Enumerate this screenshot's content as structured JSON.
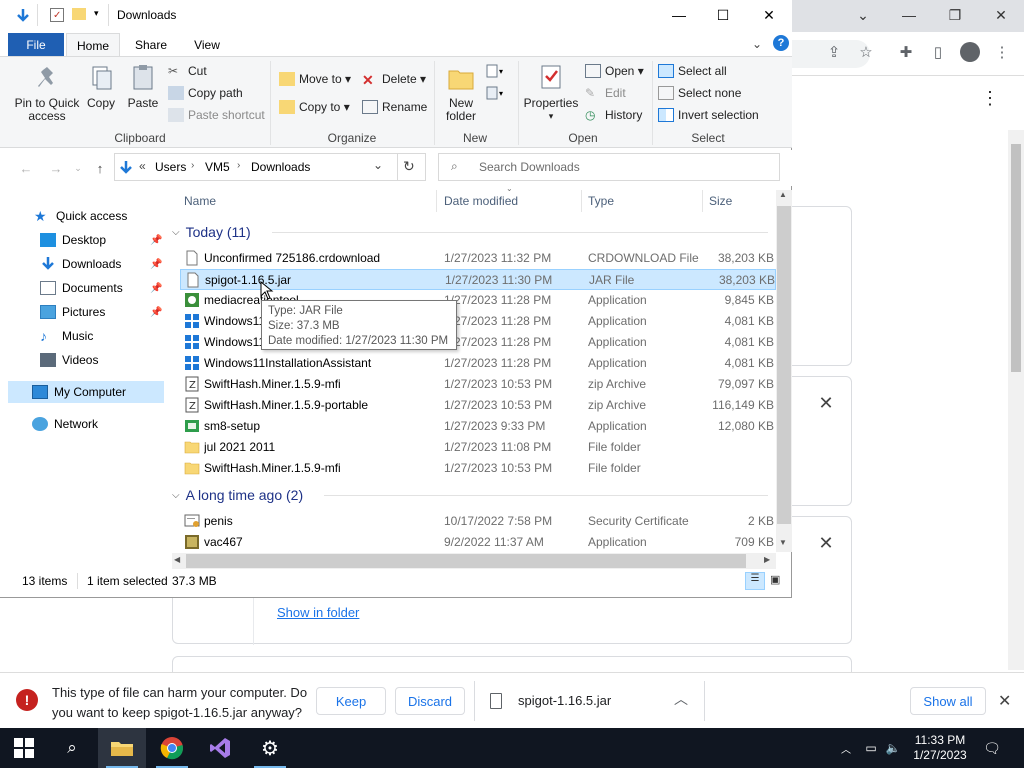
{
  "explorer": {
    "title": "Downloads",
    "tabs": [
      "File",
      "Home",
      "Share",
      "View"
    ],
    "ribbon": {
      "clipboard": {
        "pin": "Pin to Quick access",
        "copy": "Copy",
        "paste": "Paste",
        "cut": "Cut",
        "copy_path": "Copy path",
        "paste_shortcut": "Paste shortcut",
        "label": "Clipboard"
      },
      "organize": {
        "move_to": "Move to",
        "copy_to": "Copy to",
        "delete": "Delete",
        "rename": "Rename",
        "label": "Organize"
      },
      "new": {
        "new_folder": "New folder",
        "label": "New"
      },
      "open": {
        "properties": "Properties",
        "open": "Open",
        "edit": "Edit",
        "history": "History",
        "label": "Open"
      },
      "select": {
        "select_all": "Select all",
        "select_none": "Select none",
        "invert": "Invert selection",
        "label": "Select"
      }
    },
    "address": {
      "prefix": "«",
      "crumbs": [
        "Users",
        "VM5",
        "Downloads"
      ]
    },
    "search_placeholder": "Search Downloads",
    "nav": {
      "quick_access": "Quick access",
      "items": [
        "Desktop",
        "Downloads",
        "Documents",
        "Pictures",
        "Music",
        "Videos"
      ],
      "my_computer": "My Computer",
      "network": "Network"
    },
    "columns": {
      "name": "Name",
      "date": "Date modified",
      "type": "Type",
      "size": "Size"
    },
    "groups": {
      "today": "Today (11)",
      "long_ago": "A long time ago (2)"
    },
    "files_today": [
      {
        "name": "Unconfirmed 725186.crdownload",
        "date": "1/27/2023 11:32 PM",
        "type": "CRDOWNLOAD File",
        "size": "38,203 KB",
        "icon": "blank-file-icon"
      },
      {
        "name": "spigot-1.16.5.jar",
        "date": "1/27/2023 11:30 PM",
        "type": "JAR File",
        "size": "38,203 KB",
        "icon": "blank-file-icon"
      },
      {
        "name": "mediacreationtool",
        "date": "1/27/2023 11:28 PM",
        "type": "Application",
        "size": "9,845 KB",
        "icon": "media-tool-icon"
      },
      {
        "name": "Windows11",
        "date": "1/27/2023 11:28 PM",
        "type": "Application",
        "size": "4,081 KB",
        "icon": "windows-logo-icon"
      },
      {
        "name": "Windows11",
        "date": "1/27/2023 11:28 PM",
        "type": "Application",
        "size": "4,081 KB",
        "icon": "windows-logo-icon"
      },
      {
        "name": "Windows11InstallationAssistant",
        "date": "1/27/2023 11:28 PM",
        "type": "Application",
        "size": "4,081 KB",
        "icon": "windows-logo-icon"
      },
      {
        "name": "SwiftHash.Miner.1.5.9-mfi",
        "date": "1/27/2023 10:53 PM",
        "type": "zip Archive",
        "size": "79,097 KB",
        "icon": "zip-archive-icon"
      },
      {
        "name": "SwiftHash.Miner.1.5.9-portable",
        "date": "1/27/2023 10:53 PM",
        "type": "zip Archive",
        "size": "116,149 KB",
        "icon": "zip-archive-icon"
      },
      {
        "name": "sm8-setup",
        "date": "1/27/2023 9:33 PM",
        "type": "Application",
        "size": "12,080 KB",
        "icon": "setup-icon"
      },
      {
        "name": "jul 2021 2011",
        "date": "1/27/2023 11:08 PM",
        "type": "File folder",
        "size": "",
        "icon": "folder-icon"
      },
      {
        "name": "SwiftHash.Miner.1.5.9-mfi",
        "date": "1/27/2023 10:53 PM",
        "type": "File folder",
        "size": "",
        "icon": "folder-icon"
      }
    ],
    "files_old": [
      {
        "name": "penis",
        "date": "10/17/2022 7:58 PM",
        "type": "Security Certificate",
        "size": "2 KB",
        "icon": "certificate-icon"
      },
      {
        "name": "vac467",
        "date": "9/2/2022 11:37 AM",
        "type": "Application",
        "size": "709 KB",
        "icon": "app-icon"
      }
    ],
    "tooltip": {
      "type": "Type: JAR File",
      "size": "Size: 37.3 MB",
      "date": "Date modified: 1/27/2023 11:30 PM"
    },
    "status": {
      "items": "13 items",
      "selected": "1 item selected",
      "size": "37.3 MB"
    }
  },
  "chrome": {
    "show_in_folder": "Show in folder",
    "download_bar": {
      "warning": "This type of file can harm your computer. Do you want to keep spigot-1.16.5.jar anyway?",
      "keep": "Keep",
      "discard": "Discard",
      "filename": "spigot-1.16.5.jar",
      "show_all": "Show all"
    }
  },
  "taskbar": {
    "time": "11:33 PM",
    "date": "1/27/2023"
  },
  "colors": {
    "selection": "#cce8ff",
    "accent": "#1a73e8",
    "file_tab": "#1f5fb3",
    "taskbar": "#101621"
  }
}
